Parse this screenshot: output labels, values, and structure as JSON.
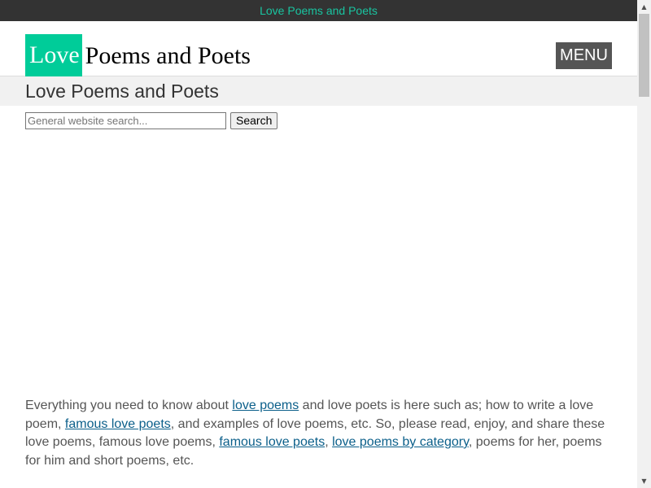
{
  "top_bar": {
    "link_text": "Love Poems and Poets"
  },
  "header": {
    "logo_highlight": "Love",
    "logo_rest": "Poems and Poets",
    "menu_label": "MENU"
  },
  "page": {
    "title": "Love Poems and Poets"
  },
  "search": {
    "placeholder": "General website search...",
    "value": "",
    "button_label": "Search"
  },
  "intro": {
    "t1": "Everything you need to know about ",
    "link1": "love poems",
    "t2": " and love poets is here such as; how to write a love poem, ",
    "link2": "famous love poets",
    "t3": ", and examples of love poems, etc. So, please read, enjoy, and share these love poems, famous love poems, ",
    "link3": "famous love poets",
    "t4": ", ",
    "link4": "love poems by category",
    "t5": ", poems for her, poems for him and short poems, etc."
  },
  "scrollbar": {
    "up_icon": "arrow-up-icon",
    "down_icon": "arrow-down-icon"
  },
  "colors": {
    "top_bar_bg": "#333333",
    "top_bar_link": "#19c4a0",
    "logo_accent": "#00cc99",
    "menu_bg": "#555555",
    "title_band_bg": "#f1f1f1",
    "link": "#0b5f8a",
    "body_text": "#555555"
  }
}
